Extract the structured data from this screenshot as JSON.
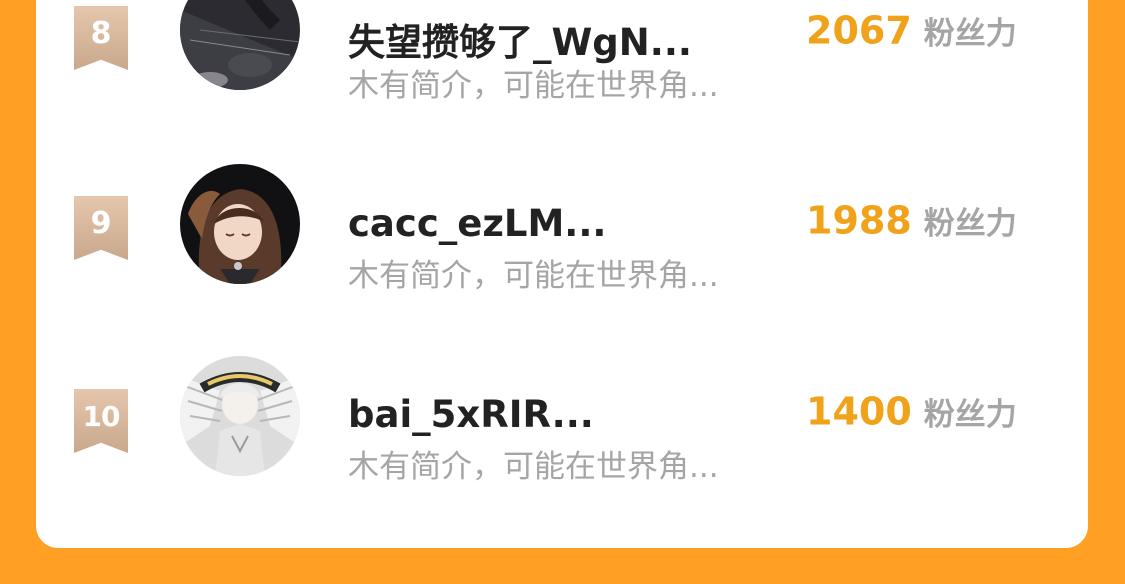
{
  "ranking": {
    "items": [
      {
        "rank": "8",
        "name": "失望攒够了_WgN...",
        "bio": "木有简介，可能在世界角...",
        "score": "2067",
        "score_unit": "粉丝力",
        "avatar": "dark-figure-avatar"
      },
      {
        "rank": "9",
        "name": "cacc_ezLM...",
        "bio": "木有简介，可能在世界角...",
        "score": "1988",
        "score_unit": "粉丝力",
        "avatar": "anime-girl-avatar"
      },
      {
        "rank": "10",
        "name": "bai_5xRIR...",
        "bio": "木有简介，可能在世界角...",
        "score": "1400",
        "score_unit": "粉丝力",
        "avatar": "winged-anime-avatar"
      }
    ]
  },
  "colors": {
    "background": "#ff9f24",
    "card": "#ffffff",
    "score": "#f0a21a",
    "badge": "#d6b69b"
  }
}
